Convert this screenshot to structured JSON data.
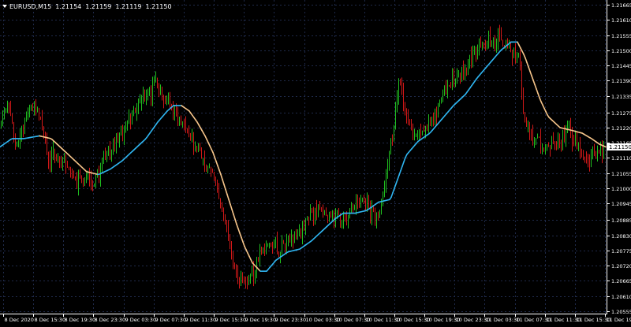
{
  "header": {
    "symbol": "EURUSD,M15",
    "open": "1.21154",
    "high": "1.21159",
    "low": "1.21119",
    "close": "1.21150"
  },
  "colors": {
    "background": "#000000",
    "grid": "#1f2a4a",
    "bull_candle": "#1fbf1f",
    "bear_candle": "#d11818",
    "ma_rising": "#2fb4ef",
    "ma_falling": "#f4c389",
    "axis_text": "#ffffff"
  },
  "chart_data": {
    "type": "line",
    "title": "EURUSD,M15",
    "ylim": [
      1.20555,
      1.21665
    ],
    "y_ticks": [
      "1.21665",
      "1.21610",
      "1.21555",
      "1.21500",
      "1.21445",
      "1.21390",
      "1.21335",
      "1.21275",
      "1.21220",
      "1.21165",
      "1.21110",
      "1.21055",
      "1.21000",
      "1.20945",
      "1.20885",
      "1.20830",
      "1.20775",
      "1.20720",
      "1.20665",
      "1.20610",
      "1.20555"
    ],
    "x_ticks": [
      "8 Dec 2020",
      "8 Dec 15:30",
      "8 Dec 19:30",
      "8 Dec 23:30",
      "9 Dec 03:30",
      "9 Dec 07:30",
      "9 Dec 11:30",
      "9 Dec 15:30",
      "9 Dec 19:30",
      "9 Dec 23:30",
      "10 Dec 03:30",
      "10 Dec 07:30",
      "10 Dec 11:30",
      "10 Dec 15:30",
      "10 Dec 19:30",
      "10 Dec 23:30",
      "11 Dec 03:30",
      "11 Dec 07:30",
      "11 Dec 11:30",
      "11 Dec 15:30",
      "11 Dec 19:30"
    ],
    "current_price": "1.21150",
    "price_path": [
      [
        0,
        1.2122
      ],
      [
        10,
        1.2132
      ],
      [
        20,
        1.2115
      ],
      [
        35,
        1.2128
      ],
      [
        48,
        1.213
      ],
      [
        60,
        1.2112
      ],
      [
        80,
        1.211
      ],
      [
        95,
        1.2102
      ],
      [
        110,
        1.2103
      ],
      [
        120,
        1.2102
      ],
      [
        135,
        1.2112
      ],
      [
        150,
        1.2118
      ],
      [
        165,
        1.2127
      ],
      [
        180,
        1.2132
      ],
      [
        190,
        1.2134
      ],
      [
        197,
        1.214
      ],
      [
        205,
        1.2133
      ],
      [
        215,
        1.213
      ],
      [
        225,
        1.2126
      ],
      [
        235,
        1.2123
      ],
      [
        245,
        1.2116
      ],
      [
        255,
        1.2113
      ],
      [
        262,
        1.2108
      ],
      [
        270,
        1.2105
      ],
      [
        280,
        1.2093
      ],
      [
        290,
        1.2081
      ],
      [
        300,
        1.2068
      ],
      [
        310,
        1.2065
      ],
      [
        320,
        1.207
      ],
      [
        330,
        1.2076
      ],
      [
        340,
        1.2081
      ],
      [
        355,
        1.2078
      ],
      [
        370,
        1.2082
      ],
      [
        385,
        1.2087
      ],
      [
        400,
        1.2093
      ],
      [
        410,
        1.2092
      ],
      [
        420,
        1.2089
      ],
      [
        430,
        1.2088
      ],
      [
        440,
        1.209
      ],
      [
        450,
        1.2094
      ],
      [
        460,
        1.2096
      ],
      [
        470,
        1.2091
      ],
      [
        480,
        1.2088
      ],
      [
        490,
        1.2108
      ],
      [
        500,
        1.2125
      ],
      [
        505,
        1.214
      ],
      [
        515,
        1.2125
      ],
      [
        525,
        1.2118
      ],
      [
        540,
        1.2123
      ],
      [
        555,
        1.2128
      ],
      [
        565,
        1.2136
      ],
      [
        575,
        1.214
      ],
      [
        590,
        1.2143
      ],
      [
        600,
        1.215
      ],
      [
        612,
        1.2153
      ],
      [
        625,
        1.2155
      ],
      [
        640,
        1.2152
      ],
      [
        650,
        1.215
      ],
      [
        658,
        1.2148
      ],
      [
        662,
        1.2128
      ],
      [
        670,
        1.212
      ],
      [
        680,
        1.2118
      ],
      [
        690,
        1.2115
      ],
      [
        700,
        1.2118
      ],
      [
        710,
        1.2116
      ],
      [
        720,
        1.2122
      ],
      [
        730,
        1.2116
      ],
      [
        740,
        1.211
      ],
      [
        750,
        1.2112
      ],
      [
        760,
        1.2113
      ],
      [
        766,
        1.2115
      ]
    ],
    "ma_path": [
      [
        0,
        1.2115
      ],
      [
        15,
        1.2118
      ],
      [
        30,
        1.2118
      ],
      [
        50,
        1.2119
      ],
      [
        65,
        1.2118
      ],
      [
        80,
        1.2114
      ],
      [
        95,
        1.211
      ],
      [
        110,
        1.2106
      ],
      [
        125,
        1.2105
      ],
      [
        140,
        1.2107
      ],
      [
        155,
        1.211
      ],
      [
        170,
        1.2114
      ],
      [
        185,
        1.2118
      ],
      [
        200,
        1.2124
      ],
      [
        212,
        1.2128
      ],
      [
        220,
        1.213
      ],
      [
        230,
        1.213
      ],
      [
        240,
        1.2128
      ],
      [
        250,
        1.2124
      ],
      [
        260,
        1.2119
      ],
      [
        270,
        1.2113
      ],
      [
        280,
        1.2105
      ],
      [
        290,
        1.2096
      ],
      [
        300,
        1.2087
      ],
      [
        310,
        1.2079
      ],
      [
        320,
        1.2073
      ],
      [
        330,
        1.207
      ],
      [
        338,
        1.207
      ],
      [
        350,
        1.2074
      ],
      [
        365,
        1.2077
      ],
      [
        380,
        1.2078
      ],
      [
        395,
        1.2081
      ],
      [
        410,
        1.2085
      ],
      [
        425,
        1.2089
      ],
      [
        435,
        1.2091
      ],
      [
        450,
        1.2091
      ],
      [
        465,
        1.2092
      ],
      [
        480,
        1.2095
      ],
      [
        495,
        1.2096
      ],
      [
        505,
        1.2104
      ],
      [
        515,
        1.2112
      ],
      [
        530,
        1.2117
      ],
      [
        545,
        1.212
      ],
      [
        560,
        1.2125
      ],
      [
        575,
        1.213
      ],
      [
        590,
        1.2134
      ],
      [
        605,
        1.214
      ],
      [
        620,
        1.2145
      ],
      [
        635,
        1.215
      ],
      [
        648,
        1.2153
      ],
      [
        656,
        1.2153
      ],
      [
        665,
        1.2148
      ],
      [
        675,
        1.214
      ],
      [
        685,
        1.2132
      ],
      [
        695,
        1.2126
      ],
      [
        710,
        1.2122
      ],
      [
        725,
        1.2121
      ],
      [
        738,
        1.212
      ],
      [
        750,
        1.2118
      ],
      [
        760,
        1.2116
      ],
      [
        768,
        1.2115
      ]
    ]
  }
}
